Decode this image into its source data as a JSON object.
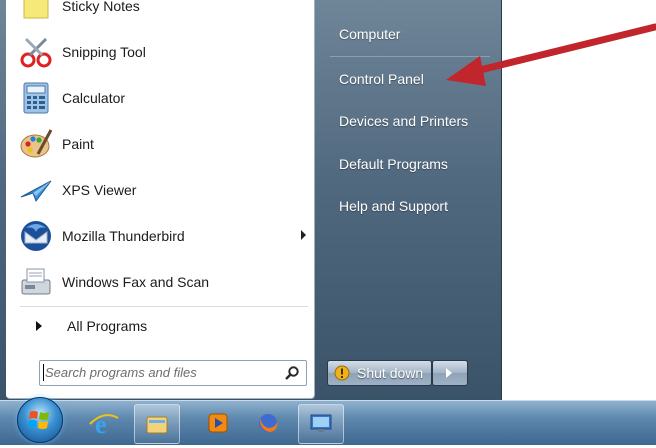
{
  "programs": [
    {
      "label": "Sticky Notes",
      "icon": "sticky-notes-icon"
    },
    {
      "label": "Snipping Tool",
      "icon": "snipping-tool-icon"
    },
    {
      "label": "Calculator",
      "icon": "calculator-icon"
    },
    {
      "label": "Paint",
      "icon": "paint-icon"
    },
    {
      "label": "XPS Viewer",
      "icon": "xps-viewer-icon"
    },
    {
      "label": "Mozilla Thunderbird",
      "icon": "thunderbird-icon",
      "has_submenu": true
    },
    {
      "label": "Windows Fax and Scan",
      "icon": "fax-scan-icon"
    }
  ],
  "all_programs_label": "All Programs",
  "search": {
    "placeholder": "Search programs and files",
    "icon": "search-icon"
  },
  "right_items": [
    {
      "label": "Computer"
    },
    {
      "label": "Control Panel"
    },
    {
      "label": "Devices and Printers"
    },
    {
      "label": "Default Programs"
    },
    {
      "label": "Help and Support"
    }
  ],
  "shutdown_label": "Shut down",
  "taskbar": [
    {
      "icon": "windows-start-orb-icon"
    },
    {
      "icon": "internet-explorer-icon"
    },
    {
      "icon": "windows-explorer-icon"
    },
    {
      "icon": "media-player-icon"
    },
    {
      "icon": "firefox-icon"
    },
    {
      "icon": "remote-desktop-icon"
    }
  ],
  "colors": {
    "annotation_arrow": "#c0262b",
    "menu_right_pane": "#4f677d",
    "taskbar": "#5d87ad"
  }
}
